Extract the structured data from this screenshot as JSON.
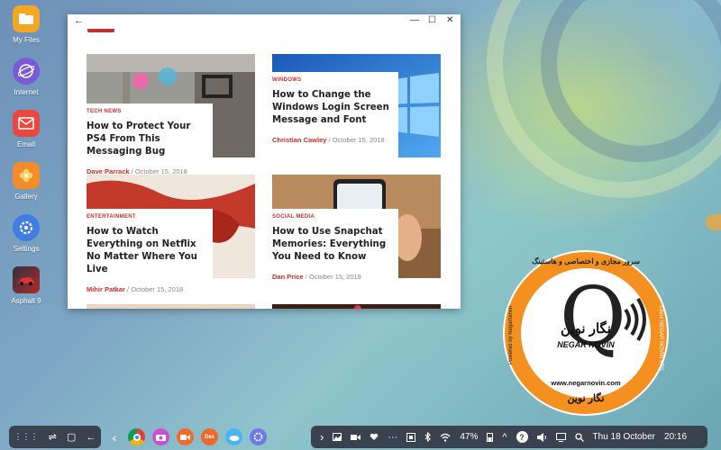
{
  "desktop": {
    "apps": [
      {
        "label": "My Files",
        "icon": "folder-icon",
        "color": "#f5a623"
      },
      {
        "label": "Internet",
        "icon": "internet-globe-icon",
        "color": "#7b5ad6"
      },
      {
        "label": "Email",
        "icon": "email-envelope-icon",
        "color": "#e9473f"
      },
      {
        "label": "Gallery",
        "icon": "gallery-flower-icon",
        "color": "#f48c2a"
      },
      {
        "label": "Settings",
        "icon": "gear-icon",
        "color": "#3f7de0"
      },
      {
        "label": "Asphalt 9",
        "icon": "asphalt-game-icon",
        "color": "#2e3240"
      }
    ]
  },
  "window": {
    "controls": [
      "←",
      "—",
      "☐",
      "✕"
    ],
    "articles": [
      {
        "category": "TECH NEWS",
        "title": "How to Protect Your PS4 From This Messaging Bug",
        "author": "Dave Parrack",
        "date": "October 15, 2018"
      },
      {
        "category": "WINDOWS",
        "title": "How to Change the Windows Login Screen Message and Font",
        "author": "Christian Cawley",
        "date": "October 15, 2018"
      },
      {
        "category": "ENTERTAINMENT",
        "title": "How to Watch Everything on Netflix No Matter Where You Live",
        "author": "Mihir Patkar",
        "date": "October 15, 2018"
      },
      {
        "category": "SOCIAL MEDIA",
        "title": "How to Use Snapchat Memories: Everything You Need to Know",
        "author": "Dan Price",
        "date": "October 15, 2018"
      }
    ],
    "date_separator": "/"
  },
  "taskbar": {
    "left_buttons": [
      "⋮⋮⋮",
      "⇌",
      "▢",
      "←"
    ],
    "nav_prev": "‹",
    "apps": [
      {
        "icon": "chrome-icon",
        "color": "#e8eaed"
      },
      {
        "icon": "camera-icon",
        "color": "#c94fd6"
      },
      {
        "icon": "video-recorder-icon",
        "color": "#f06a2c"
      },
      {
        "icon": "dex-app-icon",
        "color": "#f0682c",
        "text": "Dex"
      },
      {
        "icon": "weather-icon",
        "color": "#4ab3f0"
      },
      {
        "icon": "settings-app-icon",
        "color": "#6f7ae8"
      }
    ],
    "status": {
      "expand": "›",
      "more": "···",
      "battery": "47%",
      "up_arrow": "^",
      "help": "?",
      "date": "Thu 18 October",
      "time": "20:16"
    }
  },
  "watermark": {
    "brand_fa": "نگار نوین",
    "brand_en": "NEGAR NOVIN",
    "url": "www.negarnovin.com",
    "arc_text": "سرور مجازی و اختصاصی و هاستینگ",
    "side_text": "Linux NEGAR NOVIN VPS",
    "side_text_left": "Powered by NegarNovin",
    "colors": {
      "ring": "#f39020"
    }
  }
}
